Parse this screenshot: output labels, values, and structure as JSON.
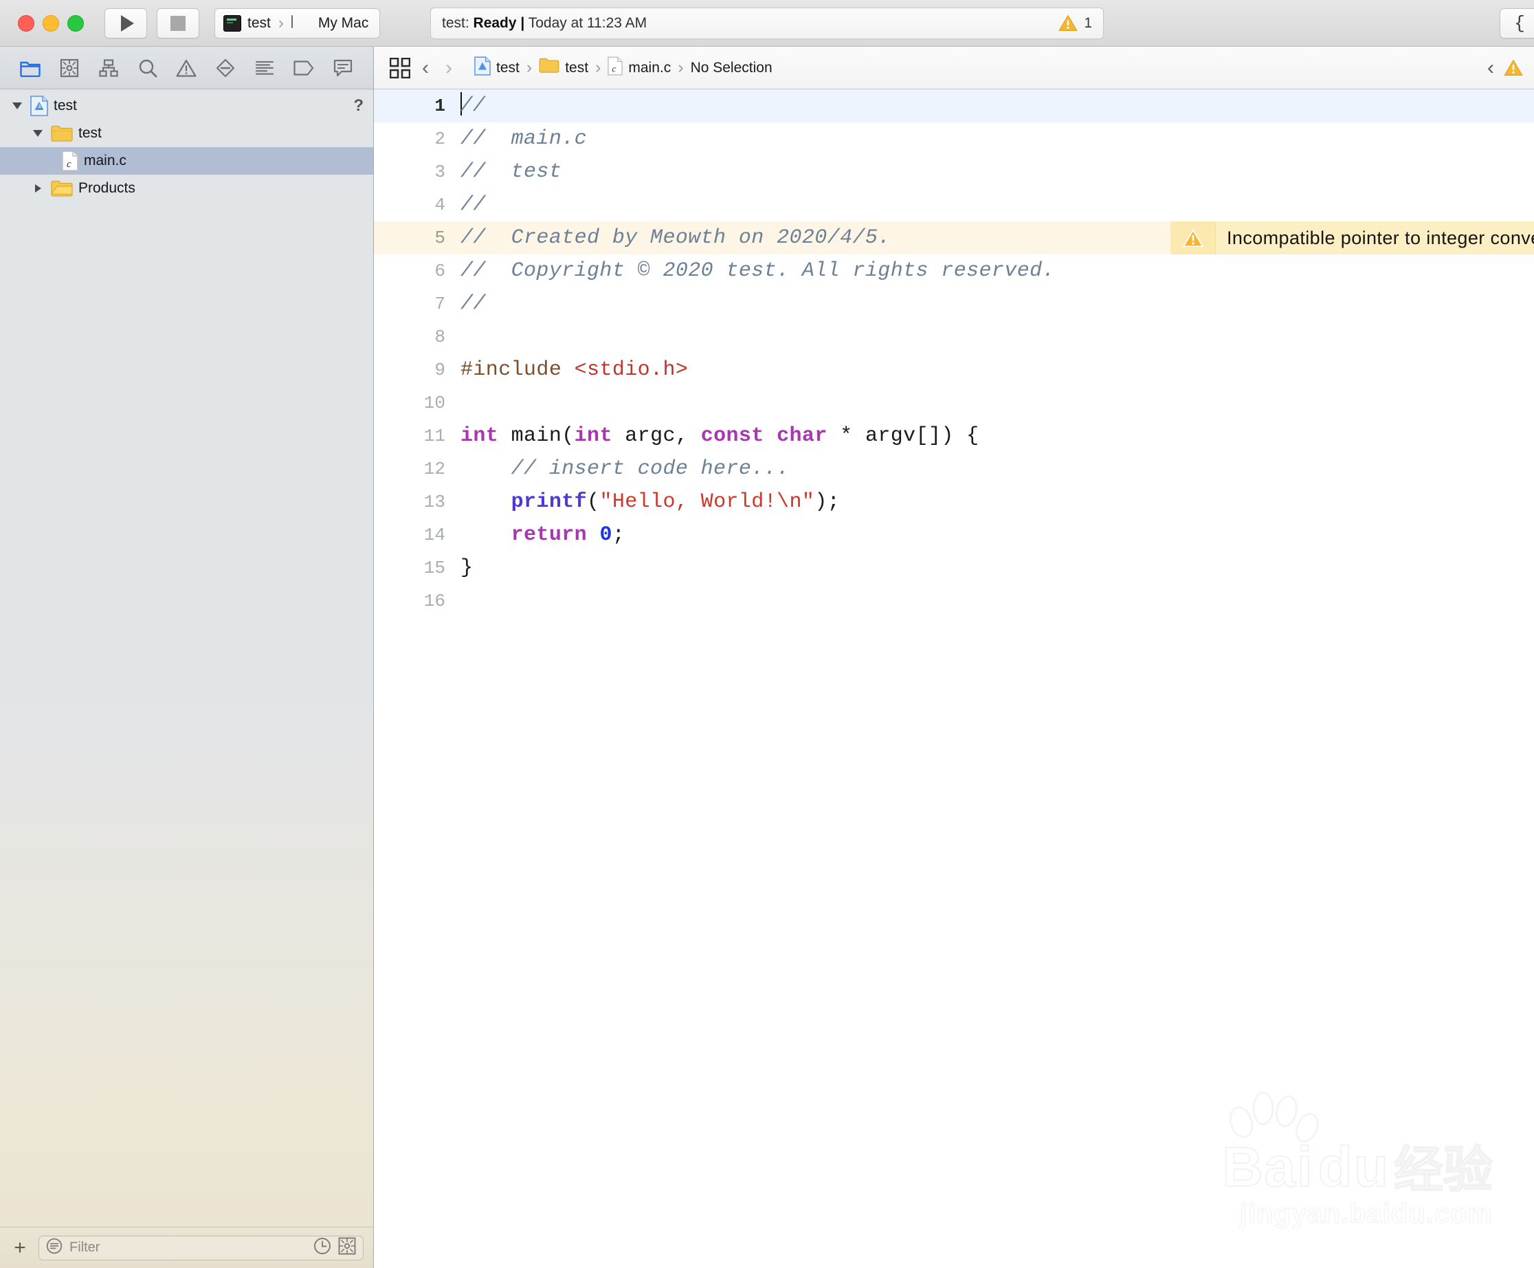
{
  "window": {
    "traffic_lights": [
      "close",
      "minimize",
      "zoom"
    ]
  },
  "toolbar": {
    "run_label": "Run",
    "stop_label": "Stop",
    "scheme_target": "test",
    "scheme_destination": "My Mac",
    "status": "test: Ready | Today at 11:23 AM",
    "status_prefix": "test: ",
    "status_bold": "Ready |",
    "status_suffix": " Today at 11:23 AM",
    "issue_count": "1",
    "editor_mode_glyph": "{"
  },
  "navigator": {
    "toolbar_icons": [
      "project-navigator-icon",
      "source-control-navigator-icon",
      "symbol-navigator-icon",
      "find-navigator-icon",
      "issue-navigator-icon",
      "test-navigator-icon",
      "debug-navigator-icon",
      "breakpoint-navigator-icon",
      "report-navigator-icon"
    ],
    "tree": [
      {
        "label": "test",
        "icon": "xcode-project-icon",
        "depth": 0,
        "state": "expanded",
        "selected": false,
        "badge": "?"
      },
      {
        "label": "test",
        "icon": "folder-icon",
        "depth": 1,
        "state": "expanded",
        "selected": false,
        "badge": ""
      },
      {
        "label": "main.c",
        "icon": "c-file-icon",
        "depth": 2,
        "state": "leaf",
        "selected": true,
        "badge": ""
      },
      {
        "label": "Products",
        "icon": "folder-icon",
        "depth": 1,
        "state": "collapsed",
        "selected": false,
        "badge": ""
      }
    ],
    "filter_placeholder": "Filter",
    "add_label": "+",
    "filter_trailing_icons": [
      "recent-icon",
      "source-control-filter-icon"
    ]
  },
  "editor": {
    "breadcrumb": [
      {
        "label": "test",
        "icon": "xcode-project-icon"
      },
      {
        "label": "test",
        "icon": "folder-icon"
      },
      {
        "label": "main.c",
        "icon": "c-file-icon"
      },
      {
        "label": "No Selection",
        "icon": ""
      }
    ],
    "nav_back": "‹",
    "nav_forward": "›",
    "related_items_icon": "related-items-icon",
    "inline_warning": {
      "text": "Incompatible pointer to integer conve.",
      "line": 5,
      "icon": "warning-triangle-icon"
    },
    "lines": [
      {
        "n": "1",
        "current": true,
        "warn": false,
        "caret": true,
        "tokens": [
          {
            "t": "//",
            "c": "cm"
          }
        ]
      },
      {
        "n": "2",
        "current": false,
        "warn": false,
        "tokens": [
          {
            "t": "//  main.c",
            "c": "cm"
          }
        ]
      },
      {
        "n": "3",
        "current": false,
        "warn": false,
        "tokens": [
          {
            "t": "//  test",
            "c": "cm"
          }
        ]
      },
      {
        "n": "4",
        "current": false,
        "warn": false,
        "tokens": [
          {
            "t": "//",
            "c": "cm"
          }
        ]
      },
      {
        "n": "5",
        "current": false,
        "warn": true,
        "tokens": [
          {
            "t": "//  Created by Meowth on 2020/4/5.",
            "c": "cm"
          }
        ]
      },
      {
        "n": "6",
        "current": false,
        "warn": false,
        "tokens": [
          {
            "t": "//  Copyright © 2020 test. All rights reserved.",
            "c": "cm"
          }
        ]
      },
      {
        "n": "7",
        "current": false,
        "warn": false,
        "tokens": [
          {
            "t": "//",
            "c": "cm"
          }
        ]
      },
      {
        "n": "8",
        "current": false,
        "warn": false,
        "tokens": []
      },
      {
        "n": "9",
        "current": false,
        "warn": false,
        "tokens": [
          {
            "t": "#include ",
            "c": "pp"
          },
          {
            "t": "<stdio.h>",
            "c": "hdr"
          }
        ]
      },
      {
        "n": "10",
        "current": false,
        "warn": false,
        "tokens": []
      },
      {
        "n": "11",
        "current": false,
        "warn": false,
        "tokens": [
          {
            "t": "int",
            "c": "kw"
          },
          {
            "t": " main(",
            "c": "pl"
          },
          {
            "t": "int",
            "c": "kw"
          },
          {
            "t": " argc, ",
            "c": "pl"
          },
          {
            "t": "const",
            "c": "kw"
          },
          {
            "t": " ",
            "c": "pl"
          },
          {
            "t": "char",
            "c": "kw"
          },
          {
            "t": " * argv[]) {",
            "c": "pl"
          }
        ]
      },
      {
        "n": "12",
        "current": false,
        "warn": false,
        "tokens": [
          {
            "t": "    // insert code here...",
            "c": "cm"
          }
        ]
      },
      {
        "n": "13",
        "current": false,
        "warn": false,
        "tokens": [
          {
            "t": "    ",
            "c": "pl"
          },
          {
            "t": "printf",
            "c": "fn"
          },
          {
            "t": "(",
            "c": "pl"
          },
          {
            "t": "\"Hello, World!\\n\"",
            "c": "str"
          },
          {
            "t": ");",
            "c": "pl"
          }
        ]
      },
      {
        "n": "14",
        "current": false,
        "warn": false,
        "tokens": [
          {
            "t": "    ",
            "c": "pl"
          },
          {
            "t": "return",
            "c": "kw"
          },
          {
            "t": " ",
            "c": "pl"
          },
          {
            "t": "0",
            "c": "num"
          },
          {
            "t": ";",
            "c": "pl"
          }
        ]
      },
      {
        "n": "15",
        "current": false,
        "warn": false,
        "tokens": [
          {
            "t": "}",
            "c": "pl"
          }
        ]
      },
      {
        "n": "16",
        "current": false,
        "warn": false,
        "tokens": []
      }
    ]
  },
  "watermark": {
    "brand_bai": "Bai",
    "brand_du": "du",
    "brand_cn": "经验",
    "url": "jingyan.baidu.com"
  },
  "colors": {
    "accent_blue": "#1f6feb",
    "warning_yellow": "#f5b731",
    "warning_bg": "#fce9b0",
    "warning_line_bg": "#fdf6e6",
    "current_line_bg": "#eef4fd",
    "selection_blue": "#b0bdd2",
    "comment": "#6d8196",
    "keyword": "#a936b0",
    "string": "#cf3528",
    "number": "#1c33e0",
    "function": "#4b3bd4",
    "preprocessor": "#7c4f2b",
    "header_path": "#c4332b"
  }
}
